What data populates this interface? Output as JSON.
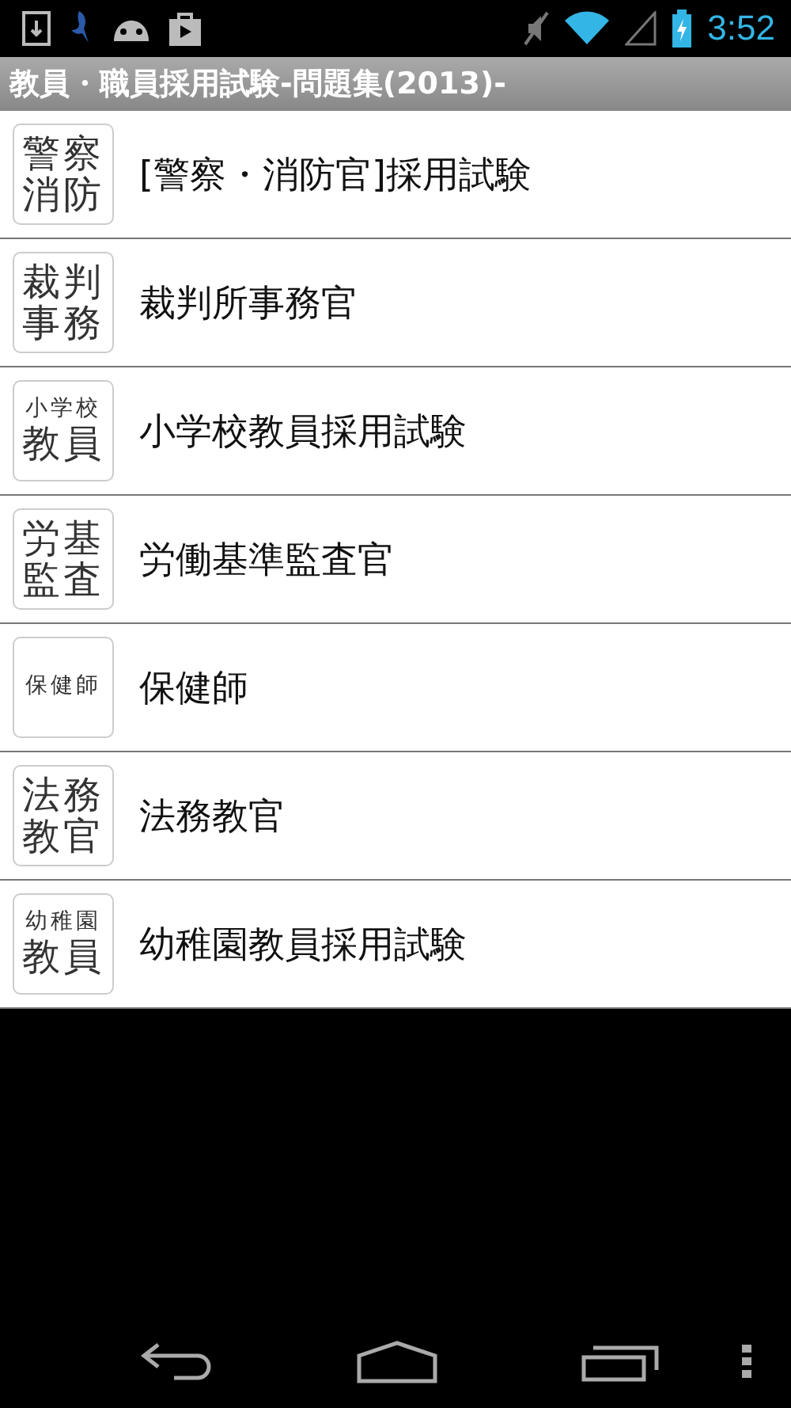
{
  "status_bar": {
    "time": "3:52"
  },
  "title_bar": {
    "title": "教員・職員採用試験-問題集(2013)-"
  },
  "list": [
    {
      "tile": [
        "警察",
        "消防"
      ],
      "label": "[警察・消防官]採用試験"
    },
    {
      "tile": [
        "裁判",
        "事務"
      ],
      "label": "裁判所事務官"
    },
    {
      "tile": [
        "小学校",
        "教員"
      ],
      "label": "小学校教員採用試験"
    },
    {
      "tile": [
        "労基",
        "監査"
      ],
      "label": "労働基準監査官"
    },
    {
      "tile": [
        "保健師"
      ],
      "label": "保健師"
    },
    {
      "tile": [
        "法務",
        "教官"
      ],
      "label": "法務教官"
    },
    {
      "tile": [
        "幼稚園",
        "教員"
      ],
      "label": "幼稚園教員採用試験"
    }
  ]
}
